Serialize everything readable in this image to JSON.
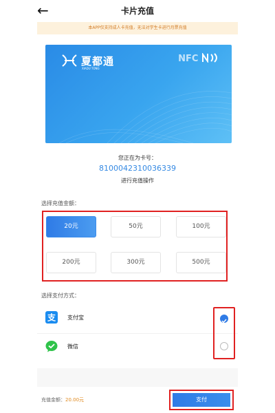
{
  "header": {
    "back_icon": "arrow-left-icon",
    "title": "卡片充值"
  },
  "notice": "本APP仅支持成人卡充值，无法对学生卡进行月票充值",
  "card": {
    "brand_cn": "夏都通",
    "brand_en": "XIADU TONG",
    "nfc_label": "NFC",
    "gradient_start": "#2a8be6",
    "gradient_end": "#5ec0f6"
  },
  "card_info": {
    "prompt_before": "您正在为卡号：",
    "card_number": "8100042310036339",
    "prompt_after": "进行充值操作"
  },
  "amount_section": {
    "label": "选择充值金额：",
    "options": [
      "20元",
      "50元",
      "100元",
      "200元",
      "300元",
      "500元"
    ],
    "selected": "20元"
  },
  "payment_section": {
    "label": "选择支付方式：",
    "methods": [
      {
        "label": "支付宝",
        "icon": "alipay-icon",
        "selected": true
      },
      {
        "label": "微信",
        "icon": "wechat-icon",
        "selected": false
      }
    ]
  },
  "footer": {
    "total_label": "充值金额：",
    "total_value": "20.00元",
    "pay_button": "支付"
  },
  "colors": {
    "accent": "#2f7be6",
    "highlight_border": "#e02020",
    "notice_bg": "#fdf1dc",
    "notice_text": "#d27c25",
    "total_value": "#e08a20"
  }
}
